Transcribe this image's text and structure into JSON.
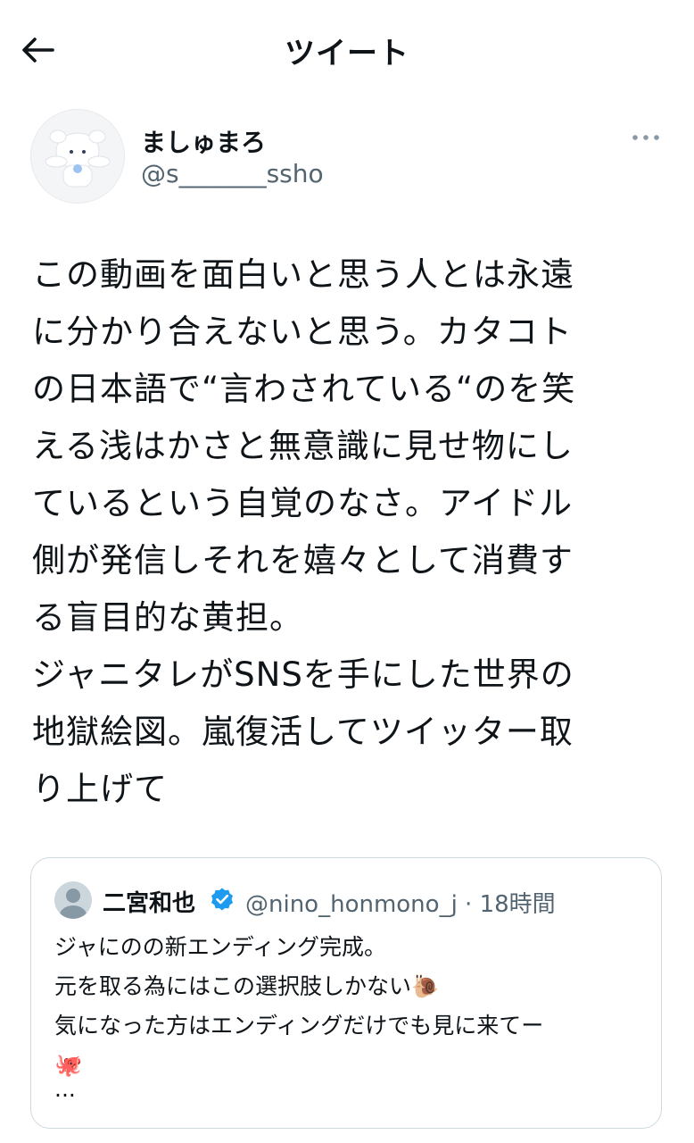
{
  "header": {
    "title": "ツイート"
  },
  "author": {
    "display_name": "ましゅまろ",
    "handle": "@s_______ssho"
  },
  "tweet": {
    "text": "この動画を面白いと思う人とは永遠\nに分かり合えないと思う。カタコト\nの日本語で“言わされている“のを笑\nえる浅はかさと無意識に見せ物にし\nているという自覚のなさ。アイドル\n側が発信しそれを嬉々として消費す\nる盲目的な黄担。\nジャニタレがSNSを手にした世界の\n地獄絵図。嵐復活してツイッター取\nり上げて"
  },
  "quoted": {
    "name": "二宮和也",
    "handle_time": "@nino_honmono_j · 18時間",
    "text": "ジャにのの新エンディング完成。\n元を取る為にはこの選択肢しかない🐌\n気になった方はエンディングだけでも見に来てー\n🐙",
    "ellipsis": "..."
  },
  "icons": [
    "back-arrow-icon",
    "more-icon",
    "verified-badge-icon"
  ],
  "colors": {
    "text": "#0f1419",
    "secondary": "#536471",
    "verified": "#1d9bf0",
    "border": "#cfd9de"
  }
}
